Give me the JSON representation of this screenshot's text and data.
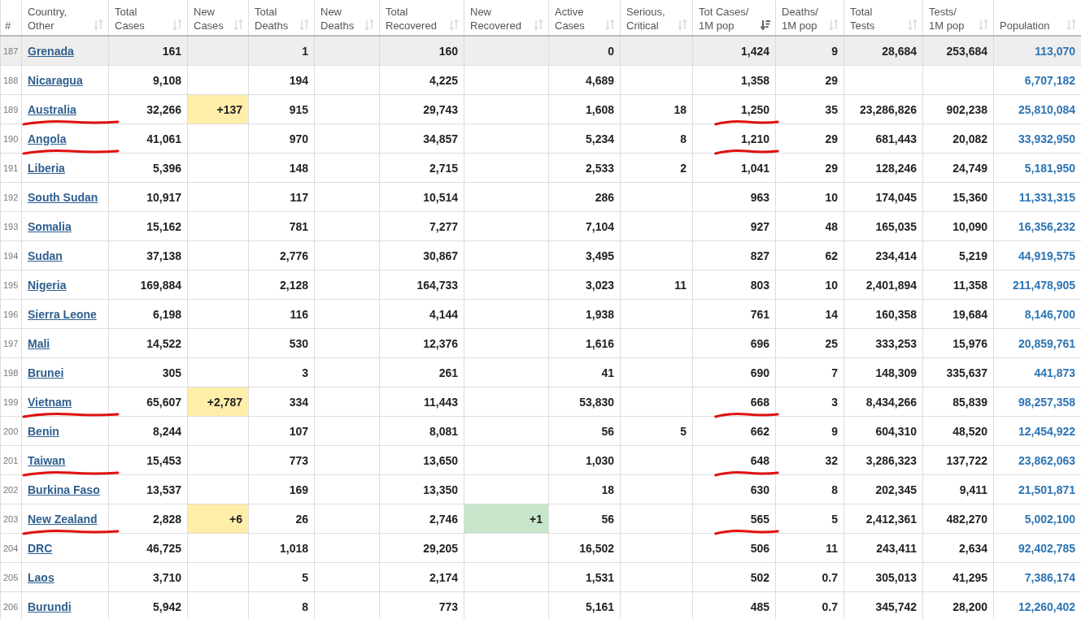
{
  "table": {
    "columns": [
      {
        "label": "#",
        "kind": "index"
      },
      {
        "label": "Country,\nOther",
        "kind": "country",
        "sorted": false
      },
      {
        "label": "Total\nCases",
        "kind": "number",
        "sorted": false
      },
      {
        "label": "New\nCases",
        "kind": "new_cases",
        "sorted": false
      },
      {
        "label": "Total\nDeaths",
        "kind": "number",
        "sorted": false
      },
      {
        "label": "New\nDeaths",
        "kind": "number",
        "sorted": false
      },
      {
        "label": "Total\nRecovered",
        "kind": "number",
        "sorted": false
      },
      {
        "label": "New\nRecovered",
        "kind": "new_recovered",
        "sorted": false
      },
      {
        "label": "Active\nCases",
        "kind": "number",
        "sorted": false
      },
      {
        "label": "Serious,\nCritical",
        "kind": "number",
        "sorted": false
      },
      {
        "label": "Tot Cases/\n1M pop",
        "kind": "number",
        "sorted": true
      },
      {
        "label": "Deaths/\n1M pop",
        "kind": "number",
        "sorted": false
      },
      {
        "label": "Total\nTests",
        "kind": "number",
        "sorted": false
      },
      {
        "label": "Tests/\n1M pop",
        "kind": "number",
        "sorted": false
      },
      {
        "label": "Population",
        "kind": "population",
        "sorted": false
      }
    ],
    "rows": [
      {
        "selected": true,
        "marked": false,
        "cells": [
          "187",
          "Grenada",
          "161",
          null,
          "1",
          null,
          "160",
          null,
          "0",
          null,
          "1,424",
          "9",
          "28,684",
          "253,684",
          "113,070"
        ]
      },
      {
        "selected": false,
        "marked": false,
        "cells": [
          "188",
          "Nicaragua",
          "9,108",
          null,
          "194",
          null,
          "4,225",
          null,
          "4,689",
          null,
          "1,358",
          "29",
          null,
          null,
          "6,707,182"
        ]
      },
      {
        "selected": false,
        "marked": true,
        "cells": [
          "189",
          "Australia",
          "32,266",
          "+137",
          "915",
          null,
          "29,743",
          null,
          "1,608",
          "18",
          "1,250",
          "35",
          "23,286,826",
          "902,238",
          "25,810,084"
        ]
      },
      {
        "selected": false,
        "marked": true,
        "cells": [
          "190",
          "Angola",
          "41,061",
          null,
          "970",
          null,
          "34,857",
          null,
          "5,234",
          "8",
          "1,210",
          "29",
          "681,443",
          "20,082",
          "33,932,950"
        ]
      },
      {
        "selected": false,
        "marked": false,
        "cells": [
          "191",
          "Liberia",
          "5,396",
          null,
          "148",
          null,
          "2,715",
          null,
          "2,533",
          "2",
          "1,041",
          "29",
          "128,246",
          "24,749",
          "5,181,950"
        ]
      },
      {
        "selected": false,
        "marked": false,
        "cells": [
          "192",
          "South Sudan",
          "10,917",
          null,
          "117",
          null,
          "10,514",
          null,
          "286",
          null,
          "963",
          "10",
          "174,045",
          "15,360",
          "11,331,315"
        ]
      },
      {
        "selected": false,
        "marked": false,
        "cells": [
          "193",
          "Somalia",
          "15,162",
          null,
          "781",
          null,
          "7,277",
          null,
          "7,104",
          null,
          "927",
          "48",
          "165,035",
          "10,090",
          "16,356,232"
        ]
      },
      {
        "selected": false,
        "marked": false,
        "cells": [
          "194",
          "Sudan",
          "37,138",
          null,
          "2,776",
          null,
          "30,867",
          null,
          "3,495",
          null,
          "827",
          "62",
          "234,414",
          "5,219",
          "44,919,575"
        ]
      },
      {
        "selected": false,
        "marked": false,
        "cells": [
          "195",
          "Nigeria",
          "169,884",
          null,
          "2,128",
          null,
          "164,733",
          null,
          "3,023",
          "11",
          "803",
          "10",
          "2,401,894",
          "11,358",
          "211,478,905"
        ]
      },
      {
        "selected": false,
        "marked": false,
        "cells": [
          "196",
          "Sierra Leone",
          "6,198",
          null,
          "116",
          null,
          "4,144",
          null,
          "1,938",
          null,
          "761",
          "14",
          "160,358",
          "19,684",
          "8,146,700"
        ]
      },
      {
        "selected": false,
        "marked": false,
        "cells": [
          "197",
          "Mali",
          "14,522",
          null,
          "530",
          null,
          "12,376",
          null,
          "1,616",
          null,
          "696",
          "25",
          "333,253",
          "15,976",
          "20,859,761"
        ]
      },
      {
        "selected": false,
        "marked": false,
        "cells": [
          "198",
          "Brunei",
          "305",
          null,
          "3",
          null,
          "261",
          null,
          "41",
          null,
          "690",
          "7",
          "148,309",
          "335,637",
          "441,873"
        ]
      },
      {
        "selected": false,
        "marked": true,
        "cells": [
          "199",
          "Vietnam",
          "65,607",
          "+2,787",
          "334",
          null,
          "11,443",
          null,
          "53,830",
          null,
          "668",
          "3",
          "8,434,266",
          "85,839",
          "98,257,358"
        ]
      },
      {
        "selected": false,
        "marked": false,
        "cells": [
          "200",
          "Benin",
          "8,244",
          null,
          "107",
          null,
          "8,081",
          null,
          "56",
          "5",
          "662",
          "9",
          "604,310",
          "48,520",
          "12,454,922"
        ]
      },
      {
        "selected": false,
        "marked": true,
        "cells": [
          "201",
          "Taiwan",
          "15,453",
          null,
          "773",
          null,
          "13,650",
          null,
          "1,030",
          null,
          "648",
          "32",
          "3,286,323",
          "137,722",
          "23,862,063"
        ]
      },
      {
        "selected": false,
        "marked": false,
        "cells": [
          "202",
          "Burkina Faso",
          "13,537",
          null,
          "169",
          null,
          "13,350",
          null,
          "18",
          null,
          "630",
          "8",
          "202,345",
          "9,411",
          "21,501,871"
        ]
      },
      {
        "selected": false,
        "marked": true,
        "cells": [
          "203",
          "New Zealand",
          "2,828",
          "+6",
          "26",
          null,
          "2,746",
          "+1",
          "56",
          null,
          "565",
          "5",
          "2,412,361",
          "482,270",
          "5,002,100"
        ]
      },
      {
        "selected": false,
        "marked": false,
        "cells": [
          "204",
          "DRC",
          "46,725",
          null,
          "1,018",
          null,
          "29,205",
          null,
          "16,502",
          null,
          "506",
          "11",
          "243,411",
          "2,634",
          "92,402,785"
        ]
      },
      {
        "selected": false,
        "marked": false,
        "cells": [
          "205",
          "Laos",
          "3,710",
          null,
          "5",
          null,
          "2,174",
          null,
          "1,531",
          null,
          "502",
          "0.7",
          "305,013",
          "41,295",
          "7,386,174"
        ]
      },
      {
        "selected": false,
        "marked": false,
        "cells": [
          "206",
          "Burundi",
          "5,942",
          null,
          "8",
          null,
          "773",
          null,
          "5,161",
          null,
          "485",
          "0.7",
          "345,742",
          "28,200",
          "12,260,402"
        ]
      }
    ]
  }
}
